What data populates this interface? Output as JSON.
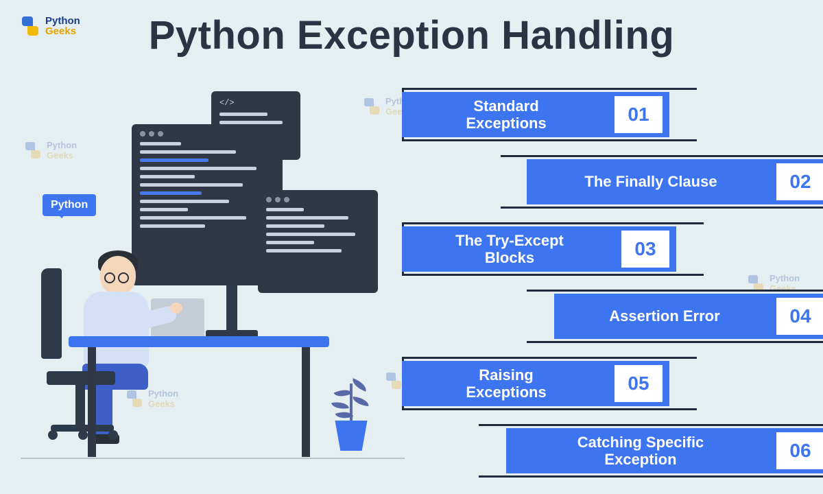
{
  "brand": {
    "line1": "Python",
    "line2": "Geeks"
  },
  "title": "Python Exception Handling",
  "tooltip": "Python",
  "watermark": {
    "line1": "Python",
    "line2": "Geeks"
  },
  "topics": [
    {
      "num": "01",
      "label": "Standard\nExceptions",
      "align": "left",
      "barWidth": 390,
      "frameWidth": 430
    },
    {
      "num": "02",
      "label": "The Finally Clause",
      "align": "right",
      "barWidth": 440,
      "frameWidth": 478
    },
    {
      "num": "03",
      "label": "The Try-Except\nBlocks",
      "align": "left",
      "barWidth": 400,
      "frameWidth": 440
    },
    {
      "num": "04",
      "label": "Assertion Error",
      "align": "right",
      "barWidth": 400,
      "frameWidth": 440
    },
    {
      "num": "05",
      "label": "Raising\nExceptions",
      "align": "left",
      "barWidth": 390,
      "frameWidth": 430
    },
    {
      "num": "06",
      "label": "Catching Specific\nException",
      "align": "right",
      "barWidth": 470,
      "frameWidth": 510
    }
  ]
}
